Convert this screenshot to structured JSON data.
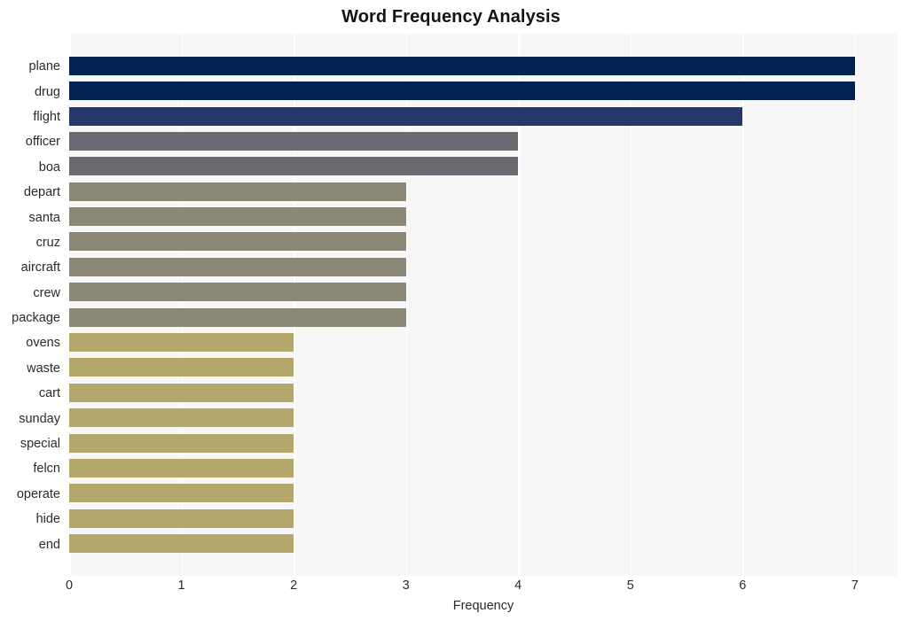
{
  "chart_data": {
    "type": "bar",
    "orientation": "horizontal",
    "title": "Word Frequency Analysis",
    "xlabel": "Frequency",
    "ylabel": "",
    "xlim": [
      0,
      7.38
    ],
    "xticks": [
      0,
      1,
      2,
      3,
      4,
      5,
      6,
      7
    ],
    "xticklabels": [
      "0",
      "1",
      "2",
      "3",
      "4",
      "5",
      "6",
      "7"
    ],
    "grid": "vertical",
    "legend": "none",
    "categories": [
      "plane",
      "drug",
      "flight",
      "officer",
      "boa",
      "depart",
      "santa",
      "cruz",
      "aircraft",
      "crew",
      "package",
      "ovens",
      "waste",
      "cart",
      "sunday",
      "special",
      "felcn",
      "operate",
      "hide",
      "end"
    ],
    "values": [
      7,
      7,
      6,
      4,
      4,
      3,
      3,
      3,
      3,
      3,
      3,
      2,
      2,
      2,
      2,
      2,
      2,
      2,
      2,
      2
    ],
    "bar_colors": [
      "#022351",
      "#022351",
      "#25376b",
      "#6a6b70",
      "#6a6b70",
      "#8c8878",
      "#8c8878",
      "#8c8878",
      "#8c8878",
      "#8c8878",
      "#8c8878",
      "#b3a76b",
      "#b3a76b",
      "#b3a76b",
      "#b3a76b",
      "#b3a76b",
      "#b3a76b",
      "#b3a76b",
      "#b3a76b",
      "#b3a76b"
    ]
  },
  "style": {
    "figure_background": "#ffffff",
    "plot_background": "#f7f7f8",
    "gridline_color": "#ffffff",
    "text_color": "#2b2b2b",
    "title_color": "#141414"
  }
}
